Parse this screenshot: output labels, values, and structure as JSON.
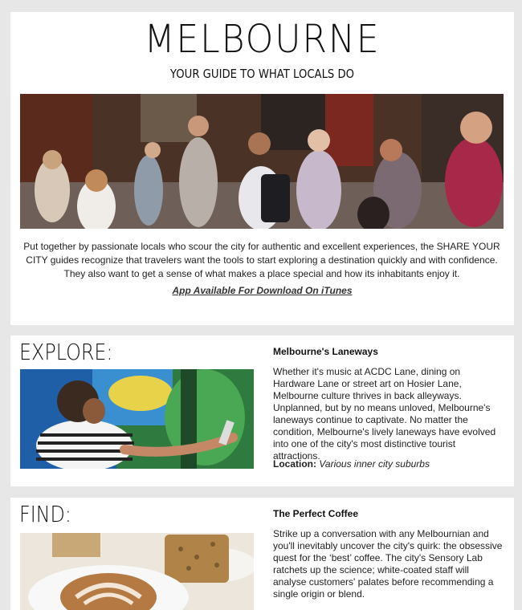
{
  "hero": {
    "title": "MELBOURNE",
    "subtitle": "YOUR GUIDE TO WHAT LOCALS DO",
    "body": "Put together by passionate locals who scour the city for authentic and excellent experiences, the SHARE YOUR CITY guides recognize that travelers want the tools to start exploring a destination quickly and with confidence. They also want to get a sense of what makes a place special and how its inhabitants enjoy it.",
    "link": "App Available For Download On iTunes"
  },
  "explore": {
    "heading": "EXPLORE:",
    "title": "Melbourne's Laneways",
    "body": "Whether it's music at ACDC Lane, dining on Hardware Lane or street art on Hosier Lane, Melbourne culture thrives in back alleyways. Unplanned, but by no means unloved, Melbourne's laneways continue to captivate. No matter the condition, Melbourne's lively laneways have evolved into one of the city's most distinctive tourist attractions.",
    "location_label": "Location:",
    "location_value": "Various inner city suburbs"
  },
  "find": {
    "heading": "FIND:",
    "title": "The Perfect Coffee",
    "body": "Strike up a conversation with any Melbournian and you'll inevitably uncover the city's quirk: the obsessive quest for the ‘best’ coffee. The city's Sensory Lab ratchets up the science; white-coated staff will analyse customers' palates before recommending a single origin or blend."
  }
}
